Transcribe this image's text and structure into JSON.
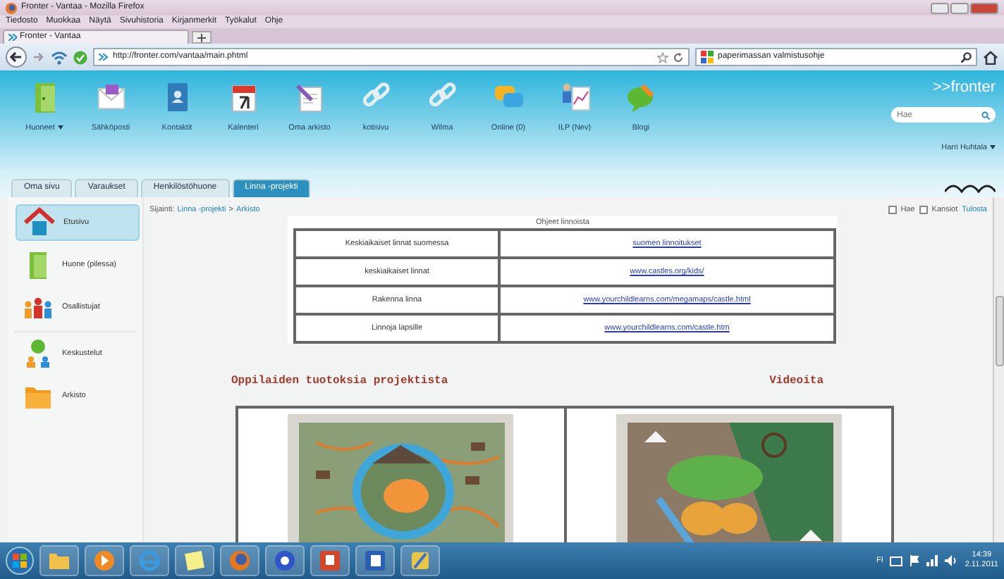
{
  "window": {
    "title": "Fronter - Vantaa - Mozilla Firefox"
  },
  "menu": [
    "Tiedosto",
    "Muokkaa",
    "Näytä",
    "Sivuhistoria",
    "Kirjanmerkit",
    "Työkalut",
    "Ohje"
  ],
  "browser_tab": {
    "title": "Fronter - Vantaa"
  },
  "address_bar": {
    "url": "http://fronter.com/vantaa/main.phtml"
  },
  "web_search": {
    "value": "paperimassan valmistusohje"
  },
  "apps": [
    {
      "label": "Huoneet",
      "caret": true
    },
    {
      "label": "Sähköposti",
      "caret": false
    },
    {
      "label": "Kontaktit",
      "caret": false
    },
    {
      "label": "Kalenteri",
      "caret": false
    },
    {
      "label": "Oma arkisto",
      "caret": false
    },
    {
      "label": "kotisivu",
      "caret": false
    },
    {
      "label": "Wilma",
      "caret": false
    },
    {
      "label": "Online (0)",
      "caret": false
    },
    {
      "label": "ILP (Nev)",
      "caret": false
    },
    {
      "label": "Blogi",
      "caret": false
    }
  ],
  "brand": ">>fronter",
  "site_search": {
    "placeholder": "Hae"
  },
  "user": "Harri Huhtala",
  "tabs": [
    {
      "label": "Oma sivu",
      "selected": false
    },
    {
      "label": "Varaukset",
      "selected": false
    },
    {
      "label": "Henkilöstöhuone",
      "selected": false
    },
    {
      "label": "Linna -projekti",
      "selected": true
    }
  ],
  "sidebar": {
    "items": [
      {
        "label": "Etusivu",
        "selected": true
      },
      {
        "label": "Huone (pilessa)",
        "selected": false
      },
      {
        "label": "Osallistujat",
        "selected": false
      },
      {
        "label": "Keskustelut",
        "selected": false
      },
      {
        "label": "Arkisto",
        "selected": false
      }
    ]
  },
  "breadcrumb": {
    "prefix": "Sijainti:",
    "items": [
      "Linna -projekti",
      "Arkisto"
    ],
    "separator": ">"
  },
  "options": [
    {
      "label": "Hae",
      "checked": false
    },
    {
      "label": "Kansiot",
      "checked": false
    }
  ],
  "print_link": "Tulosta",
  "links_table": {
    "caption": "Ohjeet linnoista",
    "rows": [
      {
        "title": "Keskiaikaiset linnat suomessa",
        "url": "suomen linnoitukset"
      },
      {
        "title": "keskiaikaiset linnat",
        "url": "www.castles.org/kids/"
      },
      {
        "title": "Rakenna linna",
        "url": "www.yourchildlearns.com/megamaps/castle.html"
      },
      {
        "title": "Linnoja lapsille",
        "url": "www.yourchildlearns.com/castle.htm"
      }
    ]
  },
  "sections": [
    {
      "heading": "Oppilaiden tuotoksia projektista"
    },
    {
      "heading": "Videoita"
    }
  ],
  "taskbar": {
    "language": "FI",
    "time": "14:39",
    "date": "2.11.2011"
  }
}
